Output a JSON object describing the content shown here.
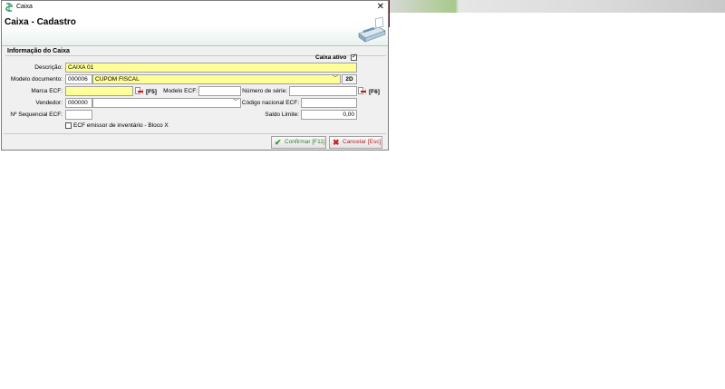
{
  "window": {
    "title": "Caixa",
    "close_glyph": "✕"
  },
  "header": {
    "title": "Caixa - Cadastro",
    "icon": "cash-register-icon"
  },
  "section": {
    "title": "Informação do Caixa"
  },
  "form": {
    "caixa_ativo_label": "Caixa ativo",
    "caixa_ativo_checked": true,
    "descricao_label": "Descrição:",
    "descricao_value": "CAIXA 01",
    "modelo_doc_label": "Modelo documento:",
    "modelo_doc_code": "000006",
    "modelo_doc_value": "CUPOM FISCAL",
    "btn_2d": "2D",
    "marca_ecf_label": "Marca ECF:",
    "marca_ecf_value": "",
    "f5_label": "[F5]",
    "modelo_ecf_label": "Modelo ECF:",
    "modelo_ecf_value": "",
    "numero_serie_label": "Número de série:",
    "numero_serie_value": "",
    "f6_label": "[F6]",
    "vendedor_label": "Vendedor:",
    "vendedor_code": "000000",
    "vendedor_value": "",
    "codigo_nacional_label": "Código nacional ECF:",
    "codigo_nacional_value": "",
    "sequencial_label": "Nº Sequencial  ECF:",
    "sequencial_value": "",
    "saldo_limite_label": "Saldo Limite:",
    "saldo_limite_value": "0,00",
    "ecf_inventario_label": "ECF emissor de inventário - Bloco X",
    "ecf_inventario_checked": false
  },
  "footer": {
    "confirmar": "Confirmar [F11]",
    "cancelar": "Cancelar [Esc]"
  },
  "colors": {
    "required_field": "#ffff99",
    "ok": "#2a9a2a",
    "cancel": "#d02020"
  }
}
